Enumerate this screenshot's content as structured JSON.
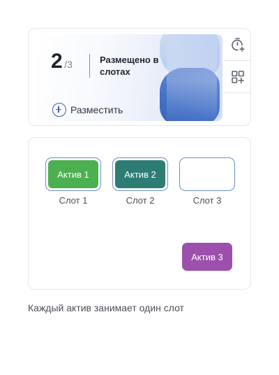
{
  "placement": {
    "placed": "2",
    "slash": "/",
    "total": "3",
    "status_label": "Размещено в слотах",
    "place_button_label": "Разместить",
    "place_icon": "plus-circle-icon"
  },
  "tools": [
    {
      "icon": "timer-add-icon"
    },
    {
      "icon": "grid-add-icon"
    }
  ],
  "slots": [
    {
      "label": "Слот 1",
      "asset": "Актив 1",
      "asset_color": "#4caf50"
    },
    {
      "label": "Слот 2",
      "asset": "Актив 2",
      "asset_color": "#2e7d74"
    },
    {
      "label": "Слот 3",
      "asset": "",
      "asset_color": ""
    }
  ],
  "free_assets": [
    {
      "label": "Актив 3",
      "color": "#9c4fad"
    }
  ],
  "hint": "Каждый актив занимает один слот",
  "colors": {
    "accent": "#3a5fa8",
    "slot_border": "#6a8fc6"
  }
}
